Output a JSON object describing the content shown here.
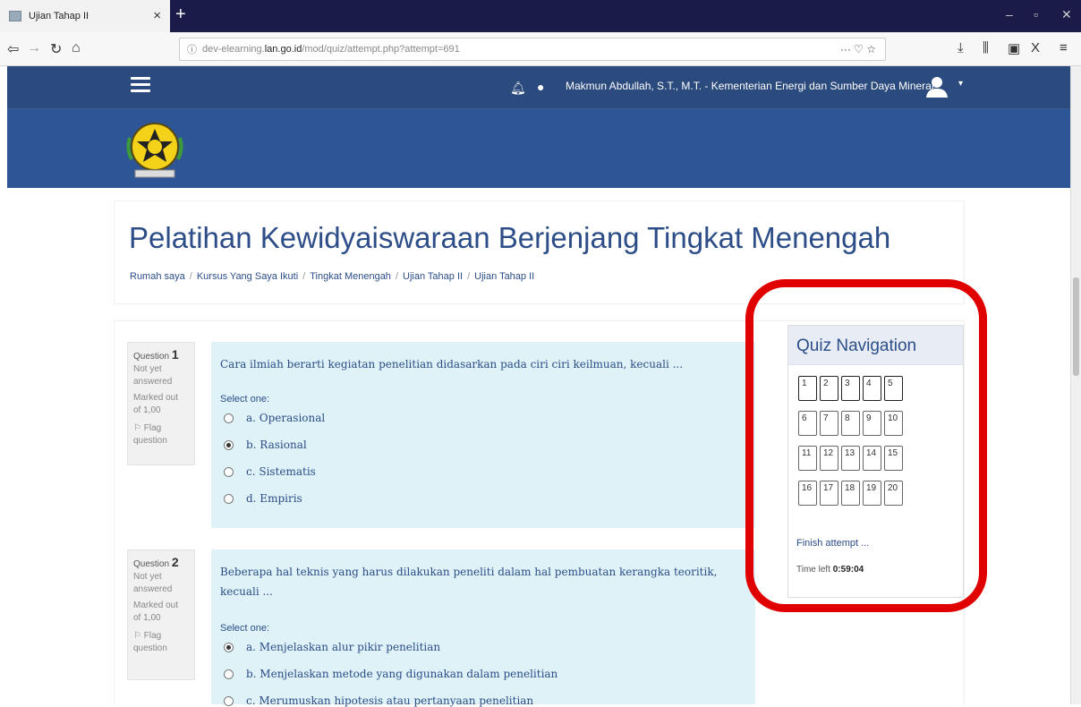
{
  "browser": {
    "tab_title": "Ujian Tahap II",
    "tab_close": "×",
    "new_tab": "+",
    "url_prefix": "dev-elearning.",
    "url_domain": "lan.go.id",
    "url_path": "/mod/quiz/attempt.php?attempt=691",
    "url_actions": "··· ♡ ☆"
  },
  "site": {
    "user_name": "Makmun Abdullah, S.T., M.T. - Kementerian Energi dan Sumber Daya Mineral",
    "header_color": "#2b4a7e"
  },
  "page": {
    "title": "Pelatihan Kewidyaiswaraan Berjenjang Tingkat Menengah",
    "breadcrumb": [
      "Rumah saya",
      "Kursus Yang Saya Ikuti",
      "Tingkat Menengah",
      "Ujian Tahap II",
      "Ujian Tahap II"
    ]
  },
  "questions": [
    {
      "label": "Question",
      "number": "1",
      "state": "Not yet answered",
      "marks": "Marked out of 1,00",
      "flag": "Flag question",
      "text": "Cara ilmiah berarti kegiatan penelitian didasarkan pada ciri ciri keilmuan, kecuali ...",
      "select_one": "Select one:",
      "answers": [
        "a. Operasional",
        "b. Rasional",
        "c. Sistematis",
        "d. Empiris"
      ],
      "selected_index": 1
    },
    {
      "label": "Question",
      "number": "2",
      "state": "Not yet answered",
      "marks": "Marked out of 1,00",
      "flag": "Flag question",
      "text_line1": "Beberapa hal teknis yang harus dilakukan peneliti dalam hal pembuatan kerangka teoritik,",
      "text_line2": "kecuali ...",
      "select_one": "Select one:",
      "answers": [
        "a. Menjelaskan alur pikir penelitian",
        "b. Menjelaskan metode yang digunakan dalam penelitian",
        "c. Merumuskan hipotesis atau pertanyaan penelitian"
      ],
      "selected_index": 0
    }
  ],
  "quiz_nav": {
    "title": "Quiz Navigation",
    "buttons": [
      "1",
      "2",
      "3",
      "4",
      "5",
      "6",
      "7",
      "8",
      "9",
      "10",
      "11",
      "12",
      "13",
      "14",
      "15",
      "16",
      "17",
      "18",
      "19",
      "20"
    ],
    "finish": "Finish attempt ...",
    "time_label": "Time left",
    "time_value": "0:59:04"
  }
}
